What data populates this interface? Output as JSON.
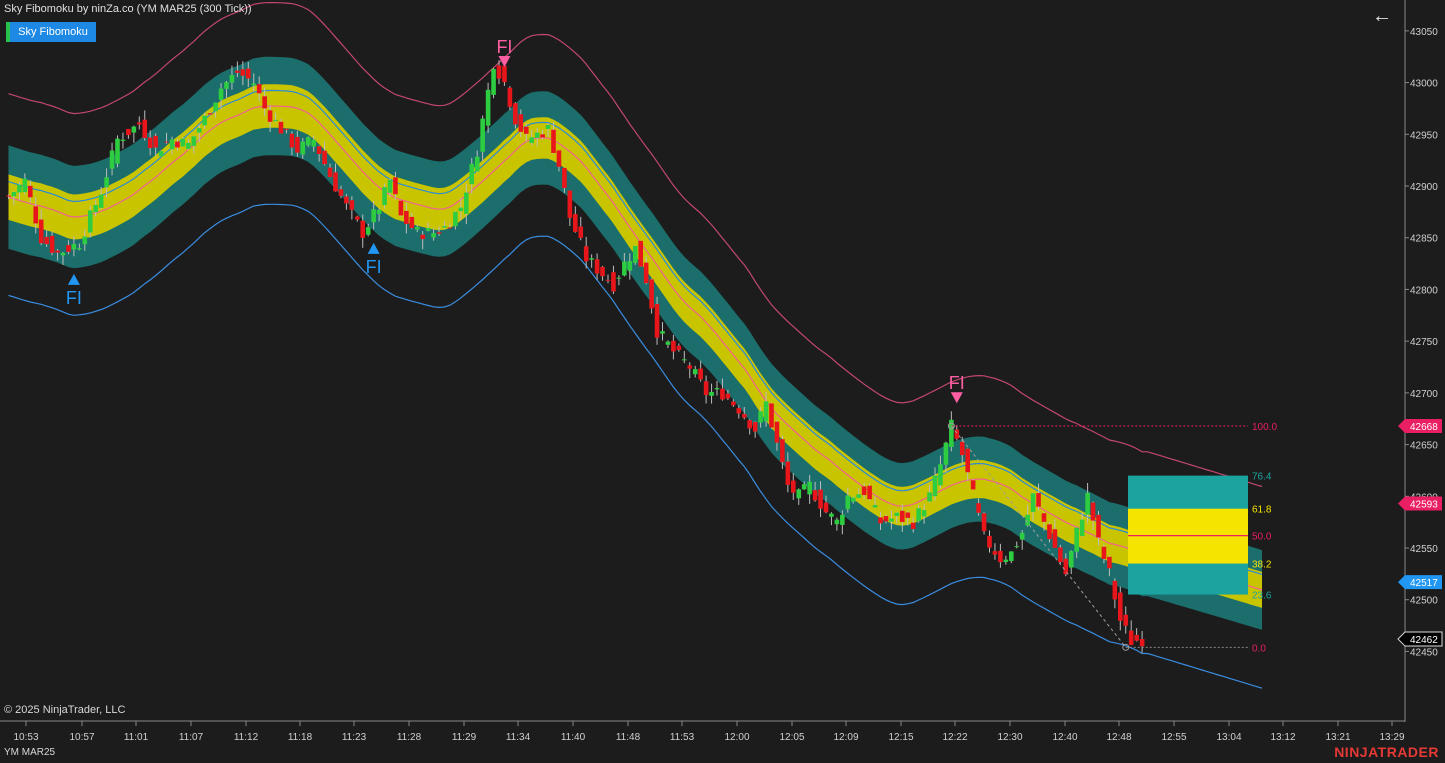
{
  "header": {
    "title": "Sky Fibomoku by ninZa.co (YM MAR25 (300 Tick))",
    "indicator_button": "Sky Fibomoku"
  },
  "footer": {
    "copyright": "© 2025 NinjaTrader, LLC",
    "instrument": "YM MAR25",
    "brand": "NINJATRADER"
  },
  "icons": {
    "back": "arrow-left-icon"
  },
  "colors": {
    "background": "#1c1c1c",
    "candle_up": "#2ecc40",
    "candle_down": "#e8161b",
    "outer_band": "#1b6e6b",
    "inner_band": "#c9c400",
    "upper_line": "#c2476e",
    "lower_line": "#3a8de0",
    "mid_line": "#f06292",
    "signal_up": "#2196f3",
    "signal_down": "#ff5fa2",
    "fib_100": "#e91e63",
    "fib_764": "#1aa39f",
    "fib_618": "#f4e400",
    "fib_50": "#e91e63",
    "fib_382": "#f4e400",
    "fib_236": "#1aa39f",
    "fib_0": "#e91e63"
  },
  "chart_data": {
    "type": "candlestick",
    "title": "Sky Fibomoku by ninZa.co (YM MAR25 (300 Tick))",
    "x_labels": [
      "10:53",
      "10:57",
      "11:01",
      "11:07",
      "11:12",
      "11:18",
      "11:23",
      "11:28",
      "11:29",
      "11:34",
      "11:40",
      "11:48",
      "11:53",
      "12:00",
      "12:05",
      "12:09",
      "12:15",
      "12:22",
      "12:30",
      "12:40",
      "12:48",
      "12:55",
      "13:04",
      "13:12",
      "13:21",
      "13:29"
    ],
    "y_ticks": [
      43050,
      43000,
      42950,
      42900,
      42850,
      42800,
      42750,
      42700,
      42650,
      42600,
      42550,
      42500,
      42450
    ],
    "ylim": [
      42405,
      43075
    ],
    "price_markers": [
      {
        "value": 42668,
        "label": "42668",
        "color": "#e91e63"
      },
      {
        "value": 42593,
        "label": "42593",
        "color": "#e91e63"
      },
      {
        "value": 42517,
        "label": "42517",
        "color": "#2196f3"
      },
      {
        "value": 42462,
        "label": "42462",
        "color": "#000000"
      }
    ],
    "fib_levels": [
      {
        "label": "100.0",
        "value": 42668
      },
      {
        "label": "76.4",
        "value": 42620
      },
      {
        "label": "61.8",
        "value": 42588
      },
      {
        "label": "50.0",
        "value": 42562
      },
      {
        "label": "38.2",
        "value": 42535
      },
      {
        "label": "23.6",
        "value": 42505
      },
      {
        "label": "0.0",
        "value": 42454
      }
    ],
    "signals": [
      {
        "label": "FI",
        "dir": "up",
        "bar": 12,
        "price": 42815
      },
      {
        "label": "FI",
        "dir": "up",
        "bar": 67,
        "price": 42845
      },
      {
        "label": "FI",
        "dir": "down",
        "bar": 91,
        "price": 43015
      },
      {
        "label": "FI",
        "dir": "down",
        "bar": 174,
        "price": 42690
      }
    ],
    "candles": [],
    "candle_anchors": [
      [
        0,
        42890
      ],
      [
        3,
        42905
      ],
      [
        6,
        42850
      ],
      [
        9,
        42835
      ],
      [
        13,
        42845
      ],
      [
        17,
        42895
      ],
      [
        20,
        42945
      ],
      [
        24,
        42960
      ],
      [
        27,
        42935
      ],
      [
        30,
        42945
      ],
      [
        33,
        42940
      ],
      [
        36,
        42965
      ],
      [
        39,
        42995
      ],
      [
        42,
        43010
      ],
      [
        45,
        43000
      ],
      [
        47,
        42975
      ],
      [
        50,
        42955
      ],
      [
        53,
        42935
      ],
      [
        56,
        42945
      ],
      [
        59,
        42910
      ],
      [
        62,
        42880
      ],
      [
        65,
        42855
      ],
      [
        68,
        42880
      ],
      [
        70,
        42905
      ],
      [
        72,
        42870
      ],
      [
        75,
        42855
      ],
      [
        78,
        42855
      ],
      [
        80,
        42860
      ],
      [
        83,
        42880
      ],
      [
        86,
        42935
      ],
      [
        89,
        43020
      ],
      [
        91,
        43000
      ],
      [
        93,
        42965
      ],
      [
        95,
        42945
      ],
      [
        97,
        42950
      ],
      [
        99,
        42955
      ],
      [
        101,
        42920
      ],
      [
        103,
        42870
      ],
      [
        106,
        42830
      ],
      [
        109,
        42815
      ],
      [
        111,
        42805
      ],
      [
        113,
        42825
      ],
      [
        115,
        42840
      ],
      [
        117,
        42810
      ],
      [
        119,
        42760
      ],
      [
        122,
        42740
      ],
      [
        125,
        42725
      ],
      [
        128,
        42700
      ],
      [
        131,
        42700
      ],
      [
        134,
        42685
      ],
      [
        137,
        42665
      ],
      [
        139,
        42690
      ],
      [
        141,
        42650
      ],
      [
        143,
        42610
      ],
      [
        145,
        42600
      ],
      [
        147,
        42610
      ],
      [
        150,
        42585
      ],
      [
        152,
        42575
      ],
      [
        154,
        42600
      ],
      [
        157,
        42605
      ],
      [
        160,
        42575
      ],
      [
        163,
        42580
      ],
      [
        166,
        42575
      ],
      [
        169,
        42600
      ],
      [
        171,
        42630
      ],
      [
        173,
        42668
      ],
      [
        175,
        42640
      ],
      [
        177,
        42600
      ],
      [
        179,
        42560
      ],
      [
        182,
        42540
      ],
      [
        184,
        42545
      ],
      [
        186,
        42565
      ],
      [
        188,
        42600
      ],
      [
        190,
        42575
      ],
      [
        192,
        42550
      ],
      [
        194,
        42525
      ],
      [
        196,
        42565
      ],
      [
        198,
        42600
      ],
      [
        200,
        42555
      ],
      [
        202,
        42525
      ],
      [
        204,
        42480
      ],
      [
        206,
        42460
      ],
      [
        208,
        42462
      ]
    ]
  }
}
